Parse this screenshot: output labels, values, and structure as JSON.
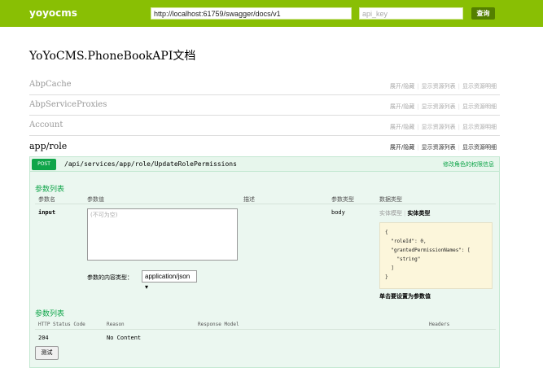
{
  "header": {
    "logo": "yoyocms",
    "url_value": "http://localhost:61759/swagger/docs/v1",
    "api_key_placeholder": "api_key",
    "explore_label": "查询"
  },
  "page_title": "YoYoCMS.PhoneBookAPI文档",
  "resources": [
    {
      "name": "AbpCache",
      "ops": [
        "展开/隐藏",
        "显示资源列表",
        "显示资源明细"
      ]
    },
    {
      "name": "AbpServiceProxies",
      "ops": [
        "展开/隐藏",
        "显示资源列表",
        "显示资源明细"
      ]
    },
    {
      "name": "Account",
      "ops": [
        "展开/隐藏",
        "显示资源列表",
        "显示资源明细"
      ]
    },
    {
      "name": "app/role",
      "ops": [
        "展开/隐藏",
        "显示资源列表",
        "显示资源明细"
      ]
    }
  ],
  "operation": {
    "method": "POST",
    "path": "/api/services/app/role/UpdateRolePermissions",
    "summary": "修改角色的权限信息",
    "params_title": "参数列表",
    "param_columns": [
      "参数名",
      "参数值",
      "描述",
      "参数类型",
      "数据类型"
    ],
    "param": {
      "name": "input",
      "value_placeholder": "(不可为空)",
      "type": "body",
      "model_tabs": [
        "实体模型",
        "实体类型"
      ],
      "signature": "{\n  \"roleId\": 0,\n  \"grantedPermissionNames\": [\n    \"string\"\n  ]\n}",
      "signature_hint": "单击要设置为参数值"
    },
    "content_type_label": "参数的内容类型：",
    "content_type_value": "application/json ▾",
    "responses_title": "参数列表",
    "response_columns": [
      "HTTP Status Code",
      "Reason",
      "Response Model",
      "Headers"
    ],
    "responses": [
      {
        "code": "204",
        "reason": "No Content"
      }
    ],
    "try_label": "测试"
  },
  "colors": {
    "header_bg": "#89bf04",
    "explore_bg": "#547f00",
    "post_badge": "#10a54a",
    "op_bg": "#ebf7f0",
    "signature_bg": "#fcf6db"
  }
}
